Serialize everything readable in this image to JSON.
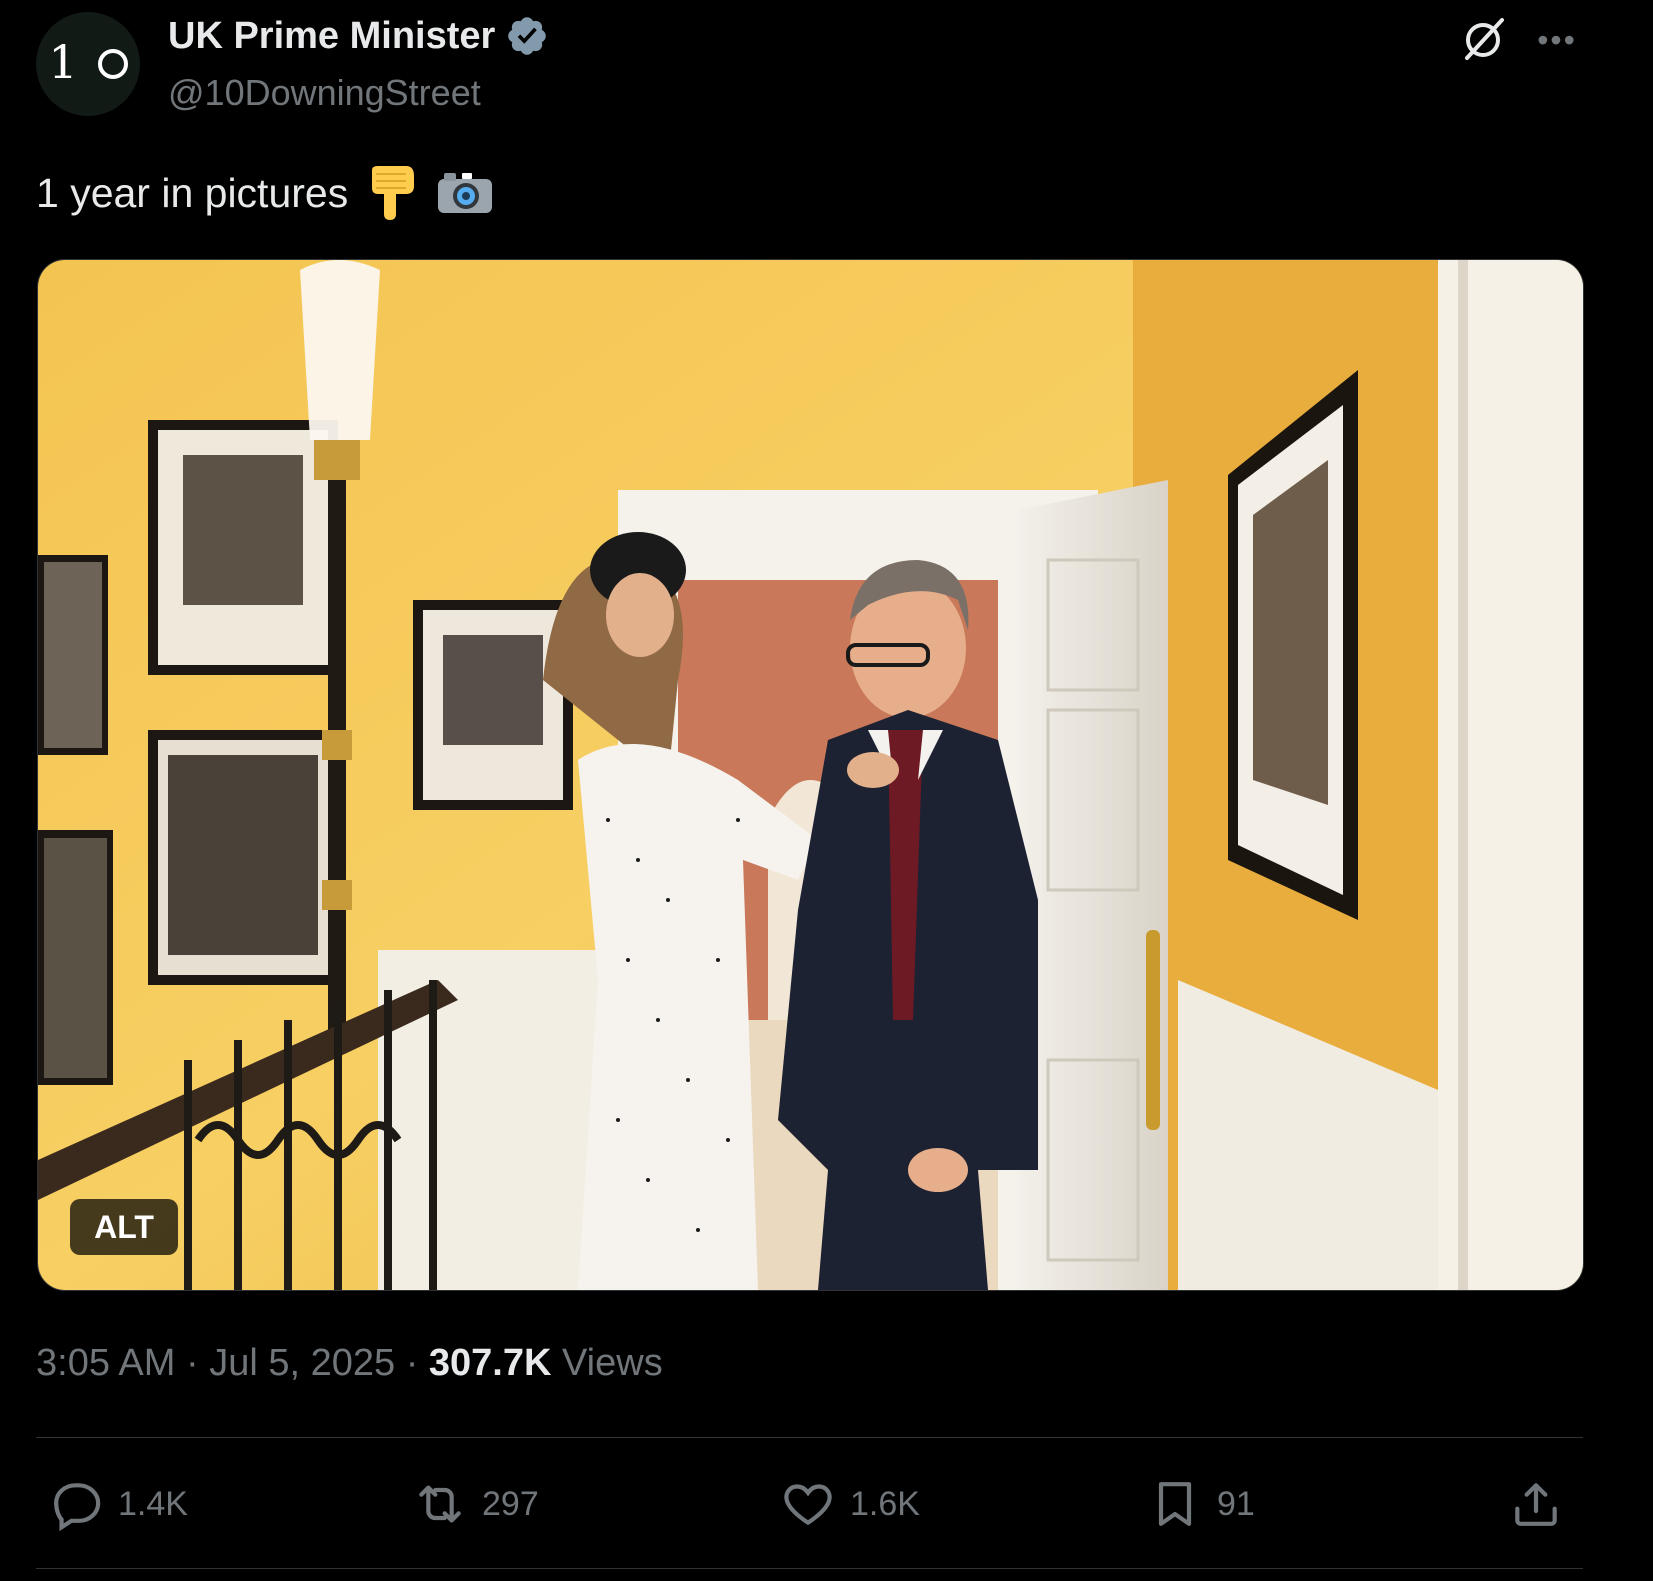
{
  "account": {
    "display_name": "UK Prime Minister",
    "handle": "@10DowningStreet",
    "avatar_text_one": "1",
    "verified": true
  },
  "tweet": {
    "text": "1 year in pictures",
    "emojis": [
      "backhand-index-pointing-down",
      "camera-with-flash"
    ]
  },
  "media": {
    "alt_label": "ALT"
  },
  "meta": {
    "time": "3:05 AM",
    "separator": "·",
    "date": "Jul 5, 2025",
    "views_count": "307.7K",
    "views_label": "Views"
  },
  "actions": {
    "replies": "1.4K",
    "reposts": "297",
    "likes": "1.6K",
    "bookmarks": "91"
  },
  "colors": {
    "background": "#000000",
    "text_primary": "#e7e9ea",
    "text_secondary": "#71767b",
    "verified": "#829aab",
    "divider": "#2f3336"
  }
}
